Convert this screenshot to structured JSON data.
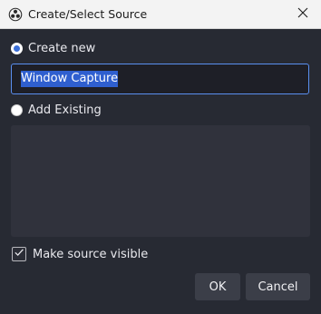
{
  "window": {
    "title": "Create/Select Source"
  },
  "options": {
    "create_new_label": "Create new",
    "add_existing_label": "Add Existing",
    "selected": "create_new"
  },
  "name_input": {
    "value": "Window Capture"
  },
  "visibility": {
    "label": "Make source visible",
    "checked": true
  },
  "buttons": {
    "ok_label": "OK",
    "cancel_label": "Cancel"
  },
  "icons": {
    "app": "obs-logo-icon",
    "close": "close-icon",
    "check": "checkmark-icon"
  },
  "colors": {
    "accent": "#3b6fd8",
    "background": "#272a33",
    "list_background": "#30323c",
    "button": "#3b3e48"
  }
}
